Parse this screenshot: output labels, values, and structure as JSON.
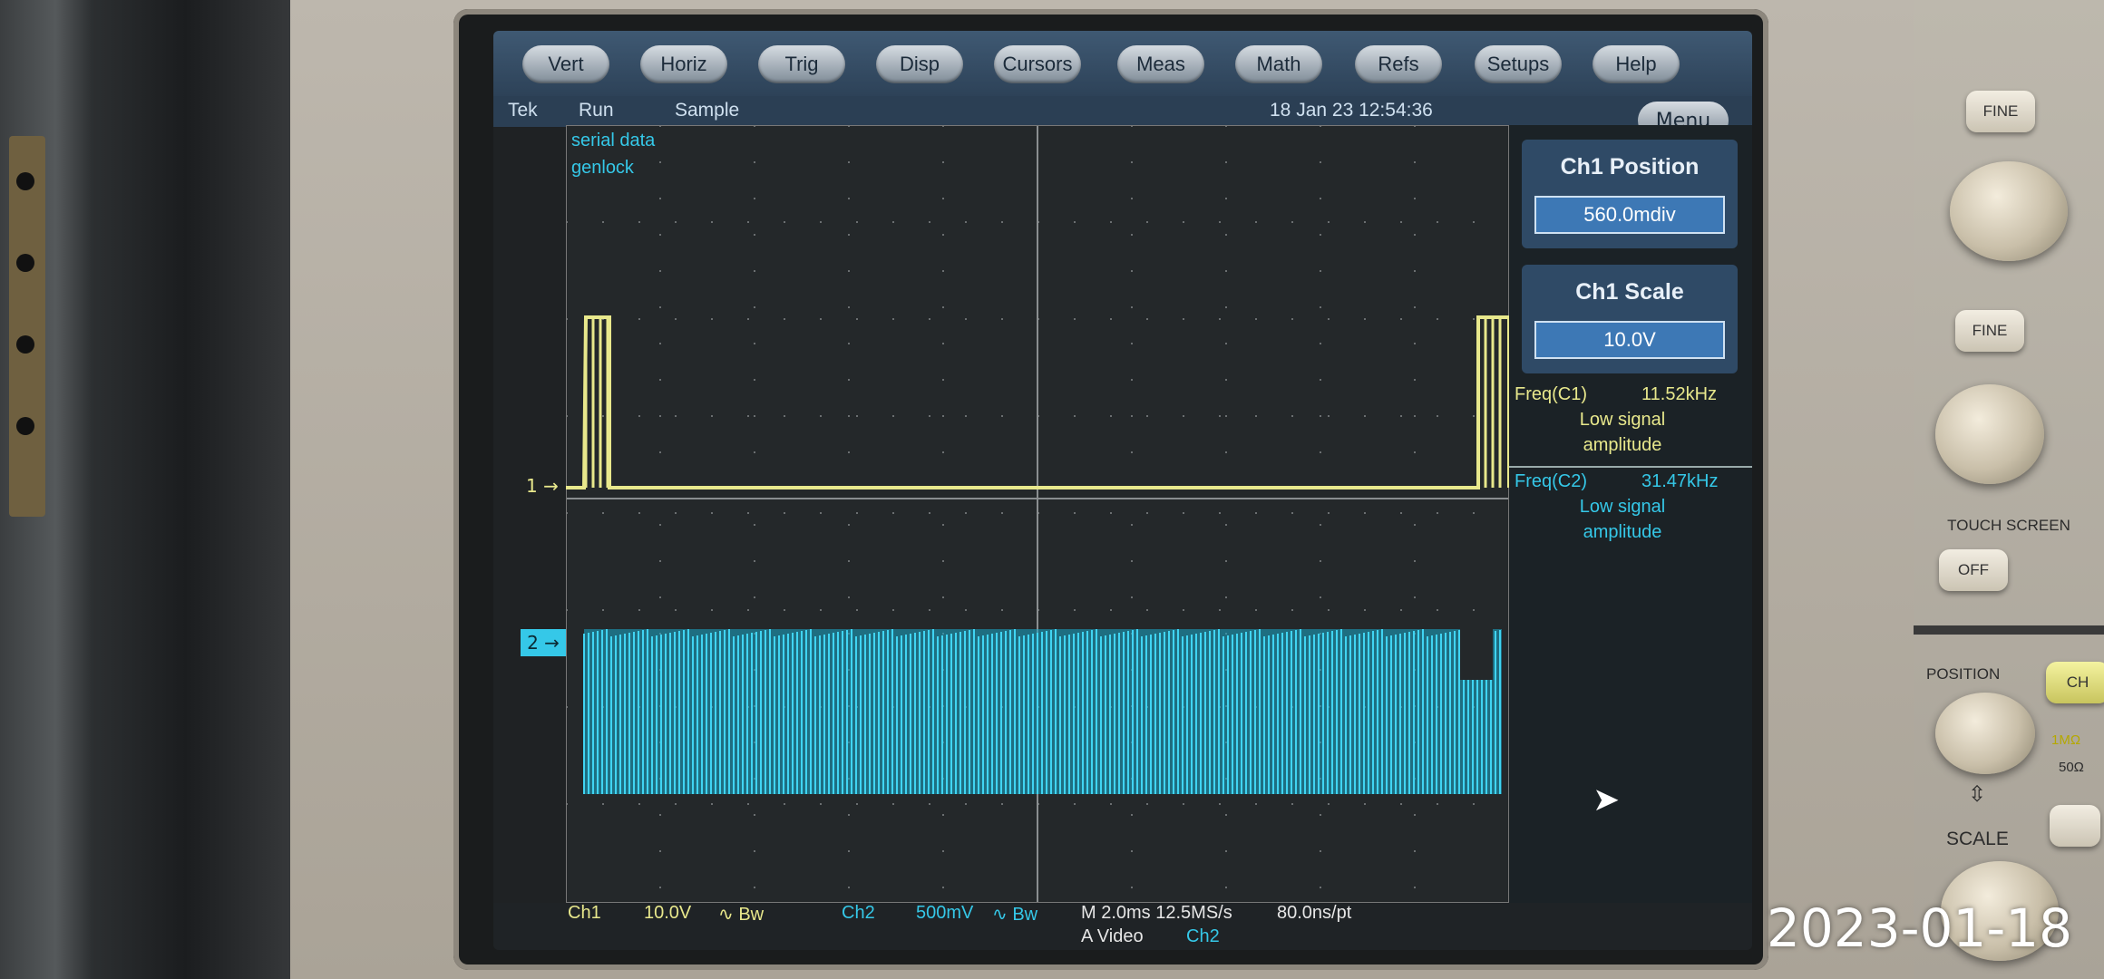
{
  "menu": {
    "items": [
      "Vert",
      "Horiz",
      "Trig",
      "Disp",
      "Cursors",
      "Meas",
      "Math",
      "Refs",
      "Setups",
      "Help"
    ],
    "menu_label": "Menu"
  },
  "status": {
    "brand": "Tek",
    "mode": "Run",
    "acquisition": "Sample",
    "datetime": "18 Jan 23 12:54:36"
  },
  "waveforms": {
    "ch1_label": "serial data",
    "ch2_label": "genlock",
    "ch1_marker": "1",
    "ch2_marker": "2",
    "ch1_color": "#e8e88c",
    "ch2_color": "#35c8e8"
  },
  "side_panel": {
    "position_title": "Ch1 Position",
    "position_value": "560.0mdiv",
    "scale_title": "Ch1 Scale",
    "scale_value": "10.0V",
    "meas1_name": "Freq(C1)",
    "meas1_value": "11.52kHz",
    "meas1_note_1": "Low signal",
    "meas1_note_2": "amplitude",
    "meas2_name": "Freq(C2)",
    "meas2_value": "31.47kHz",
    "meas2_note_1": "Low signal",
    "meas2_note_2": "amplitude"
  },
  "bottom": {
    "ch1": "Ch1",
    "ch1_scale": "10.0V",
    "ch1_coupling": "∿ Bw",
    "ch2": "Ch2",
    "ch2_scale": "500mV",
    "ch2_coupling": "∿ Bw",
    "timebase": "M 2.0ms 12.5MS/s",
    "record": "80.0ns/pt",
    "trigger_mode": "A Video",
    "trigger_source": "Ch2"
  },
  "front_panel": {
    "fine_1": "FINE",
    "fine_2": "FINE",
    "touch_screen": "TOUCH SCREEN",
    "touch_off": "OFF",
    "position": "POSITION",
    "scale": "SCALE",
    "ch_button": "CH",
    "impedance_1": "1MΩ",
    "impedance_2": "50Ω"
  },
  "photo_date": "2023-01-18"
}
